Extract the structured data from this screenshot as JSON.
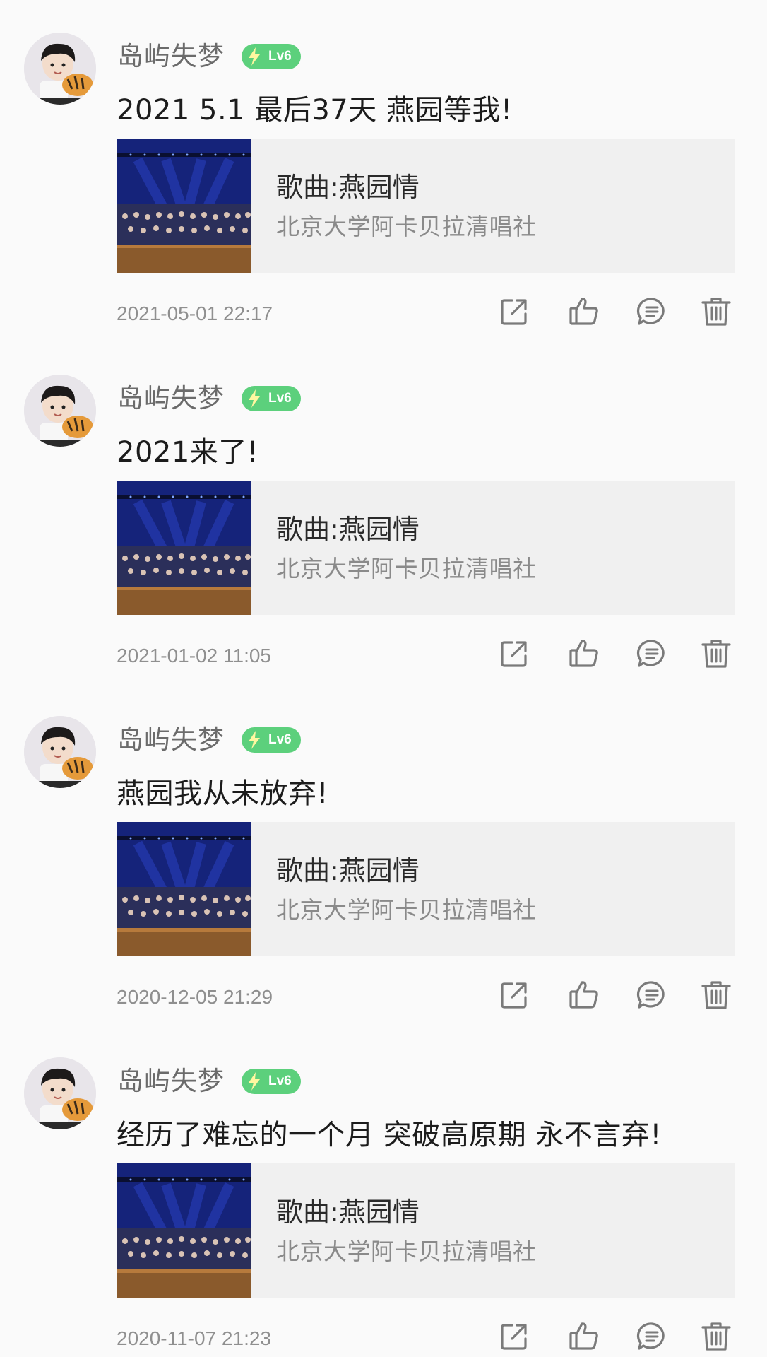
{
  "posts": [
    {
      "username": "岛屿失梦",
      "level": "Lv6",
      "comment": "2021 5.1 最后37天 燕园等我!",
      "song": {
        "title": "歌曲:燕园情",
        "artist": "北京大学阿卡贝拉清唱社"
      },
      "timestamp": "2021-05-01 22:17"
    },
    {
      "username": "岛屿失梦",
      "level": "Lv6",
      "comment": "2021来了!",
      "song": {
        "title": "歌曲:燕园情",
        "artist": "北京大学阿卡贝拉清唱社"
      },
      "timestamp": "2021-01-02 11:05"
    },
    {
      "username": "岛屿失梦",
      "level": "Lv6",
      "comment": "燕园我从未放弃!",
      "song": {
        "title": "歌曲:燕园情",
        "artist": "北京大学阿卡贝拉清唱社"
      },
      "timestamp": "2020-12-05 21:29"
    },
    {
      "username": "岛屿失梦",
      "level": "Lv6",
      "comment": "经历了难忘的一个月 突破高原期 永不言弃!",
      "song": {
        "title": "歌曲:燕园情",
        "artist": "北京大学阿卡贝拉清唱社"
      },
      "timestamp": "2020-11-07 21:23"
    }
  ],
  "icons": {
    "share": "share-icon",
    "like": "thumbs-up-icon",
    "reply": "comment-icon",
    "delete": "trash-icon",
    "level": "lightning-icon"
  },
  "colors": {
    "background": "#fafafa",
    "badge": "#5cd07c",
    "card": "#f0f0f0",
    "text": "#1c1c1c",
    "muted": "#8f8f8f",
    "icon": "#7a7a7a"
  }
}
